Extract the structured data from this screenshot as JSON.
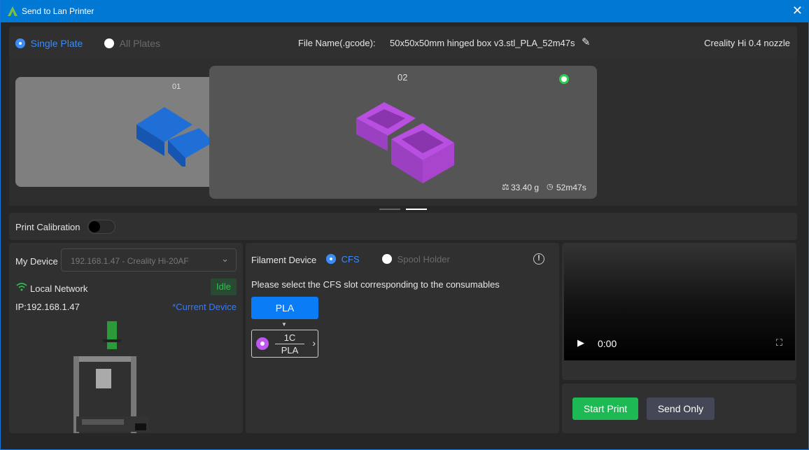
{
  "window": {
    "title": "Send to Lan Printer",
    "close": "✕"
  },
  "top": {
    "single_plate": "Single Plate",
    "all_plates": "All Plates",
    "file_label": "File Name(.gcode):",
    "file_name": "50x50x50mm hinged box v3.stl_PLA_52m47s",
    "printer": "Creality Hi 0.4 nozzle"
  },
  "plates": [
    {
      "label": "01",
      "color": "#1f6fd6"
    },
    {
      "label": "02",
      "color": "#b84fe0",
      "weight": "33.40 g",
      "time": "52m47s"
    }
  ],
  "calibration": {
    "label": "Print Calibration",
    "enabled": false
  },
  "device": {
    "label": "My Device",
    "selected": "192.168.1.47 - Creality Hi-20AF",
    "network": "Local Network",
    "status": "Idle",
    "ip": "IP:192.168.1.47",
    "current": "*Current Device"
  },
  "filament": {
    "label": "Filament Device",
    "cfs": "CFS",
    "spool": "Spool Holder",
    "instruction": "Please select the CFS slot corresponding to the consumables",
    "material": "PLA",
    "slot_id": "1C",
    "slot_material": "PLA",
    "slot_color": "#c055f0"
  },
  "video": {
    "time": "0:00"
  },
  "actions": {
    "start": "Start Print",
    "send": "Send Only"
  }
}
